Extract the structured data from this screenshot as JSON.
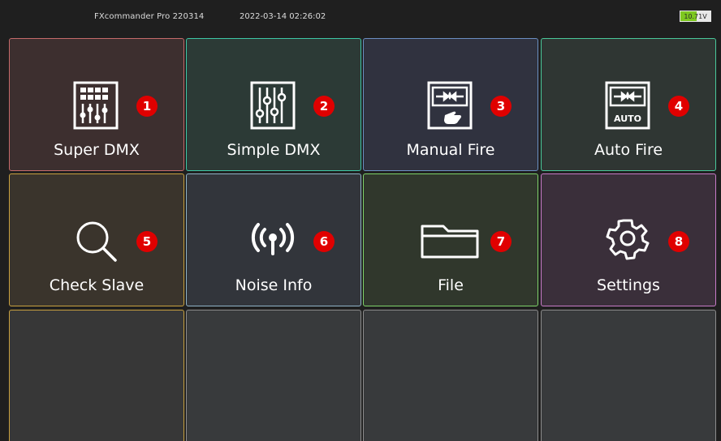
{
  "header": {
    "app_title": "FXcommander Pro 220314",
    "datetime": "2022-03-14 02:26:02",
    "battery": {
      "voltage": "10.71V",
      "level": 0.55,
      "color": "#7ec820"
    }
  },
  "tiles": [
    {
      "label": "Super DMX",
      "badge": "1",
      "icon": "super-dmx-grid-slider-icon",
      "border": "#c56a6a",
      "bg": "#3d2f2f"
    },
    {
      "label": "Simple DMX",
      "badge": "2",
      "icon": "slider-mixer-icon",
      "border": "#3ec8a6",
      "bg": "#2c3a36"
    },
    {
      "label": "Manual Fire",
      "badge": "3",
      "icon": "manual-fire-hand-icon",
      "border": "#6b8fc2",
      "bg": "#30323f"
    },
    {
      "label": "Auto Fire",
      "badge": "4",
      "icon": "auto-fire-icon",
      "border": "#49c89a",
      "bg": "#2f3633"
    },
    {
      "label": "Check Slave",
      "badge": "5",
      "icon": "search-icon",
      "border": "#c9a13f",
      "bg": "#3a342c"
    },
    {
      "label": "Noise Info",
      "badge": "6",
      "icon": "signal-broadcast-icon",
      "border": "#8fb3c8",
      "bg": "#32353b"
    },
    {
      "label": "File",
      "badge": "7",
      "icon": "folder-icon",
      "border": "#7ed36a",
      "bg": "#30372c"
    },
    {
      "label": "Settings",
      "badge": "8",
      "icon": "gear-icon",
      "border": "#c87bc8",
      "bg": "#3a2f3a"
    },
    {
      "label": "",
      "badge": "",
      "icon": "",
      "border": "#c9a13f",
      "bg": "#373737"
    },
    {
      "label": "",
      "badge": "",
      "icon": "",
      "border": "#8c8c8c",
      "bg": "#383a3c"
    },
    {
      "label": "",
      "badge": "",
      "icon": "",
      "border": "#8c8c8c",
      "bg": "#383a3c"
    },
    {
      "label": "",
      "badge": "",
      "icon": "",
      "border": "#8c8c8c",
      "bg": "#383a3c"
    }
  ]
}
